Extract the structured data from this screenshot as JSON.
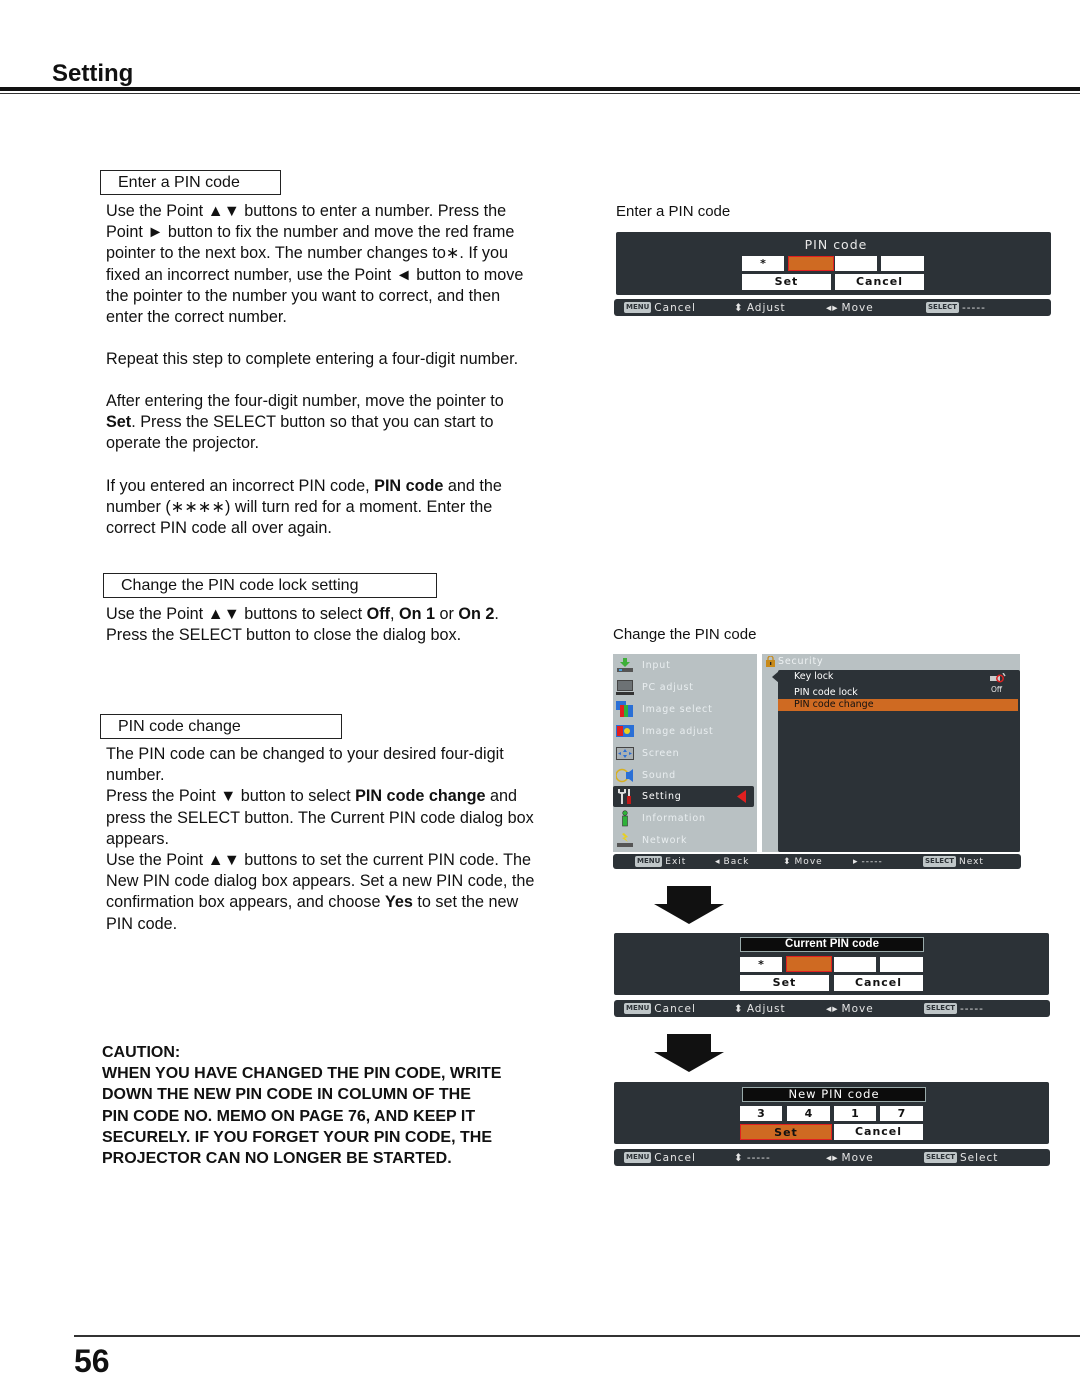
{
  "header": {
    "title": "Setting"
  },
  "sections": {
    "enter_pin": {
      "heading": "Enter a PIN code",
      "para1": [
        "Use the Point ▲▼ buttons to enter a number. Press the",
        "Point ► button to fix the number and move the red frame",
        "pointer to the next box. The number changes to∗. If you",
        "fixed an incorrect number, use the Point ◄ button to move",
        "the pointer to the number you want to correct, and then",
        "enter the correct number."
      ],
      "para2": "Repeat this step to complete entering a four-digit number.",
      "para3": {
        "line1": "After entering the four-digit number, move the pointer to",
        "line2_bold": "Set",
        "line2_rest": ". Press the SELECT button so that you can start to",
        "line3": "operate the projector."
      },
      "para4": {
        "line1_a": "If you entered an incorrect PIN code, ",
        "line1_bold": "PIN code",
        "line1_b": " and the",
        "line2": "number (∗∗∗∗) will turn red for a moment. Enter the",
        "line3": "correct PIN code all over again."
      }
    },
    "lock_setting": {
      "heading": "Change the PIN code lock setting",
      "line1_a": "Use the Point ▲▼ buttons to select ",
      "opt1": "Off",
      "sep1": ", ",
      "opt2": "On 1",
      "sep2": " or ",
      "opt3": "On 2",
      "end": ".",
      "line2": "Press the SELECT button to close the dialog box."
    },
    "pin_change": {
      "heading": "PIN code change",
      "line1": "The PIN code can be changed to your desired four-digit",
      "line2": "number.",
      "line3_a": "Press the Point ▼ button to select ",
      "line3_bold": "PIN code change",
      "line3_b": " and",
      "line4": "press the SELECT button. The Current PIN code dialog box",
      "line5": "appears.",
      "line6": "Use the Point ▲▼ buttons to set the current PIN code. The",
      "line7": "New PIN code dialog box appears. Set a new PIN code, the",
      "line8_a": "confirmation box appears, and choose ",
      "line8_bold": "Yes",
      "line8_b": " to set the new",
      "line9": "PIN code."
    },
    "caution": {
      "title": "CAUTION:",
      "lines": [
        "WHEN YOU HAVE CHANGED THE PIN CODE, WRITE",
        "DOWN THE NEW PIN CODE IN COLUMN OF THE",
        "PIN CODE NO. MEMO ON PAGE 76, AND KEEP IT",
        "SECURELY. IF YOU FORGET YOUR PIN CODE, THE",
        "PROJECTOR CAN NO LONGER BE STARTED."
      ]
    }
  },
  "screens": {
    "enter_pin": {
      "caption": "Enter a PIN code",
      "dialog_title": "PIN code",
      "digits": [
        "*",
        "",
        "",
        ""
      ],
      "active_digit": 1,
      "set_label": "Set",
      "cancel_label": "Cancel",
      "guide": [
        {
          "key": "MENU",
          "label": "Cancel"
        },
        {
          "key": "⬍",
          "label": "Adjust"
        },
        {
          "key": "◂▸",
          "label": "Move"
        },
        {
          "key": "SELECT",
          "label": "-----"
        }
      ]
    },
    "change_pin": {
      "caption": "Change the PIN code",
      "menu_items": [
        "Input",
        "PC adjust",
        "Image select",
        "Image adjust",
        "Screen",
        "Sound",
        "Setting",
        "Information",
        "Network"
      ],
      "selected_menu": "Setting",
      "submenu_title": "Security",
      "sub_items": [
        {
          "label": "Key lock",
          "value": "projector-lock-icon"
        },
        {
          "label": "PIN code lock",
          "value": "Off"
        },
        {
          "label": "PIN code change",
          "value": ""
        }
      ],
      "selected_sub": 2,
      "guide": [
        {
          "key": "MENU",
          "label": "Exit"
        },
        {
          "key": "◂",
          "label": "Back"
        },
        {
          "key": "⬍",
          "label": "Move"
        },
        {
          "key": "▸",
          "label": "-----"
        },
        {
          "key": "SELECT",
          "label": "Next"
        }
      ]
    },
    "current_pin": {
      "dialog_title": "Current PIN code",
      "digits": [
        "*",
        "",
        "",
        ""
      ],
      "active_digit": 1,
      "set_label": "Set",
      "cancel_label": "Cancel",
      "guide": [
        {
          "key": "MENU",
          "label": "Cancel"
        },
        {
          "key": "⬍",
          "label": "Adjust"
        },
        {
          "key": "◂▸",
          "label": "Move"
        },
        {
          "key": "SELECT",
          "label": "-----"
        }
      ]
    },
    "new_pin": {
      "dialog_title": "New PIN code",
      "digits": [
        "3",
        "4",
        "1",
        "7"
      ],
      "set_label": "Set",
      "cancel_label": "Cancel",
      "set_active": true,
      "guide": [
        {
          "key": "MENU",
          "label": "Cancel"
        },
        {
          "key": "⬍",
          "label": "-----"
        },
        {
          "key": "◂▸",
          "label": "Move"
        },
        {
          "key": "SELECT",
          "label": "Select"
        }
      ]
    }
  },
  "colors": {
    "osd_background": "#2c3237",
    "highlight_orange": "#cf6a22",
    "pointer_red": "#e02020",
    "menu_panel": "#b9c1c3"
  },
  "footer": {
    "page_number": "56"
  }
}
